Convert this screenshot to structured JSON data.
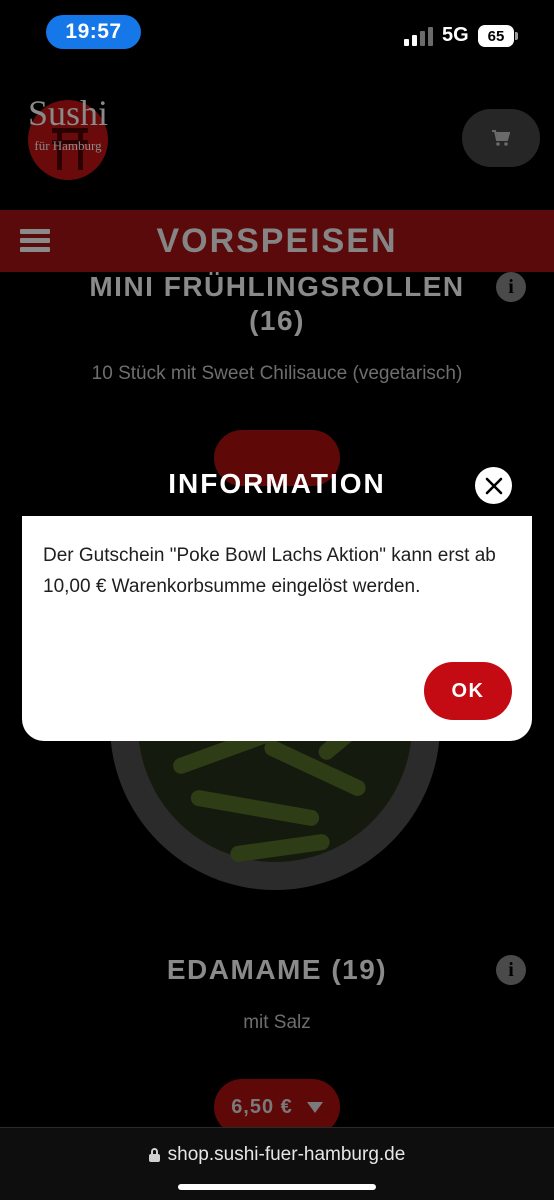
{
  "status_bar": {
    "time": "19:57",
    "network": "5G",
    "battery": "65"
  },
  "header": {
    "logo_title": "Sushi",
    "logo_subtitle": "für Hamburg",
    "cart_icon": "cart-icon"
  },
  "category": {
    "title": "VORSPEISEN",
    "menu_icon": "hamburger-menu-icon"
  },
  "products": [
    {
      "title": "MINI FRÜHLINGSROLLEN (16)",
      "description": "10 Stück mit Sweet Chilisauce (vegetarisch)",
      "info": "i"
    },
    {
      "title": "EDAMAME (19)",
      "description": "mit Salz",
      "price": "6,50 €",
      "info": "i"
    }
  ],
  "modal": {
    "title": "INFORMATION",
    "message": "Der Gutschein \"Poke Bowl Lachs Aktion\" kann erst ab 10,00 € Warenkorbsumme eingelöst werden.",
    "ok_label": "OK"
  },
  "browser": {
    "url": "shop.sushi-fuer-hamburg.de"
  },
  "colors": {
    "status_pill": "#1677e8",
    "accent": "#c40a12",
    "modal_bg": "#ffffff",
    "overlay": "#000000"
  }
}
